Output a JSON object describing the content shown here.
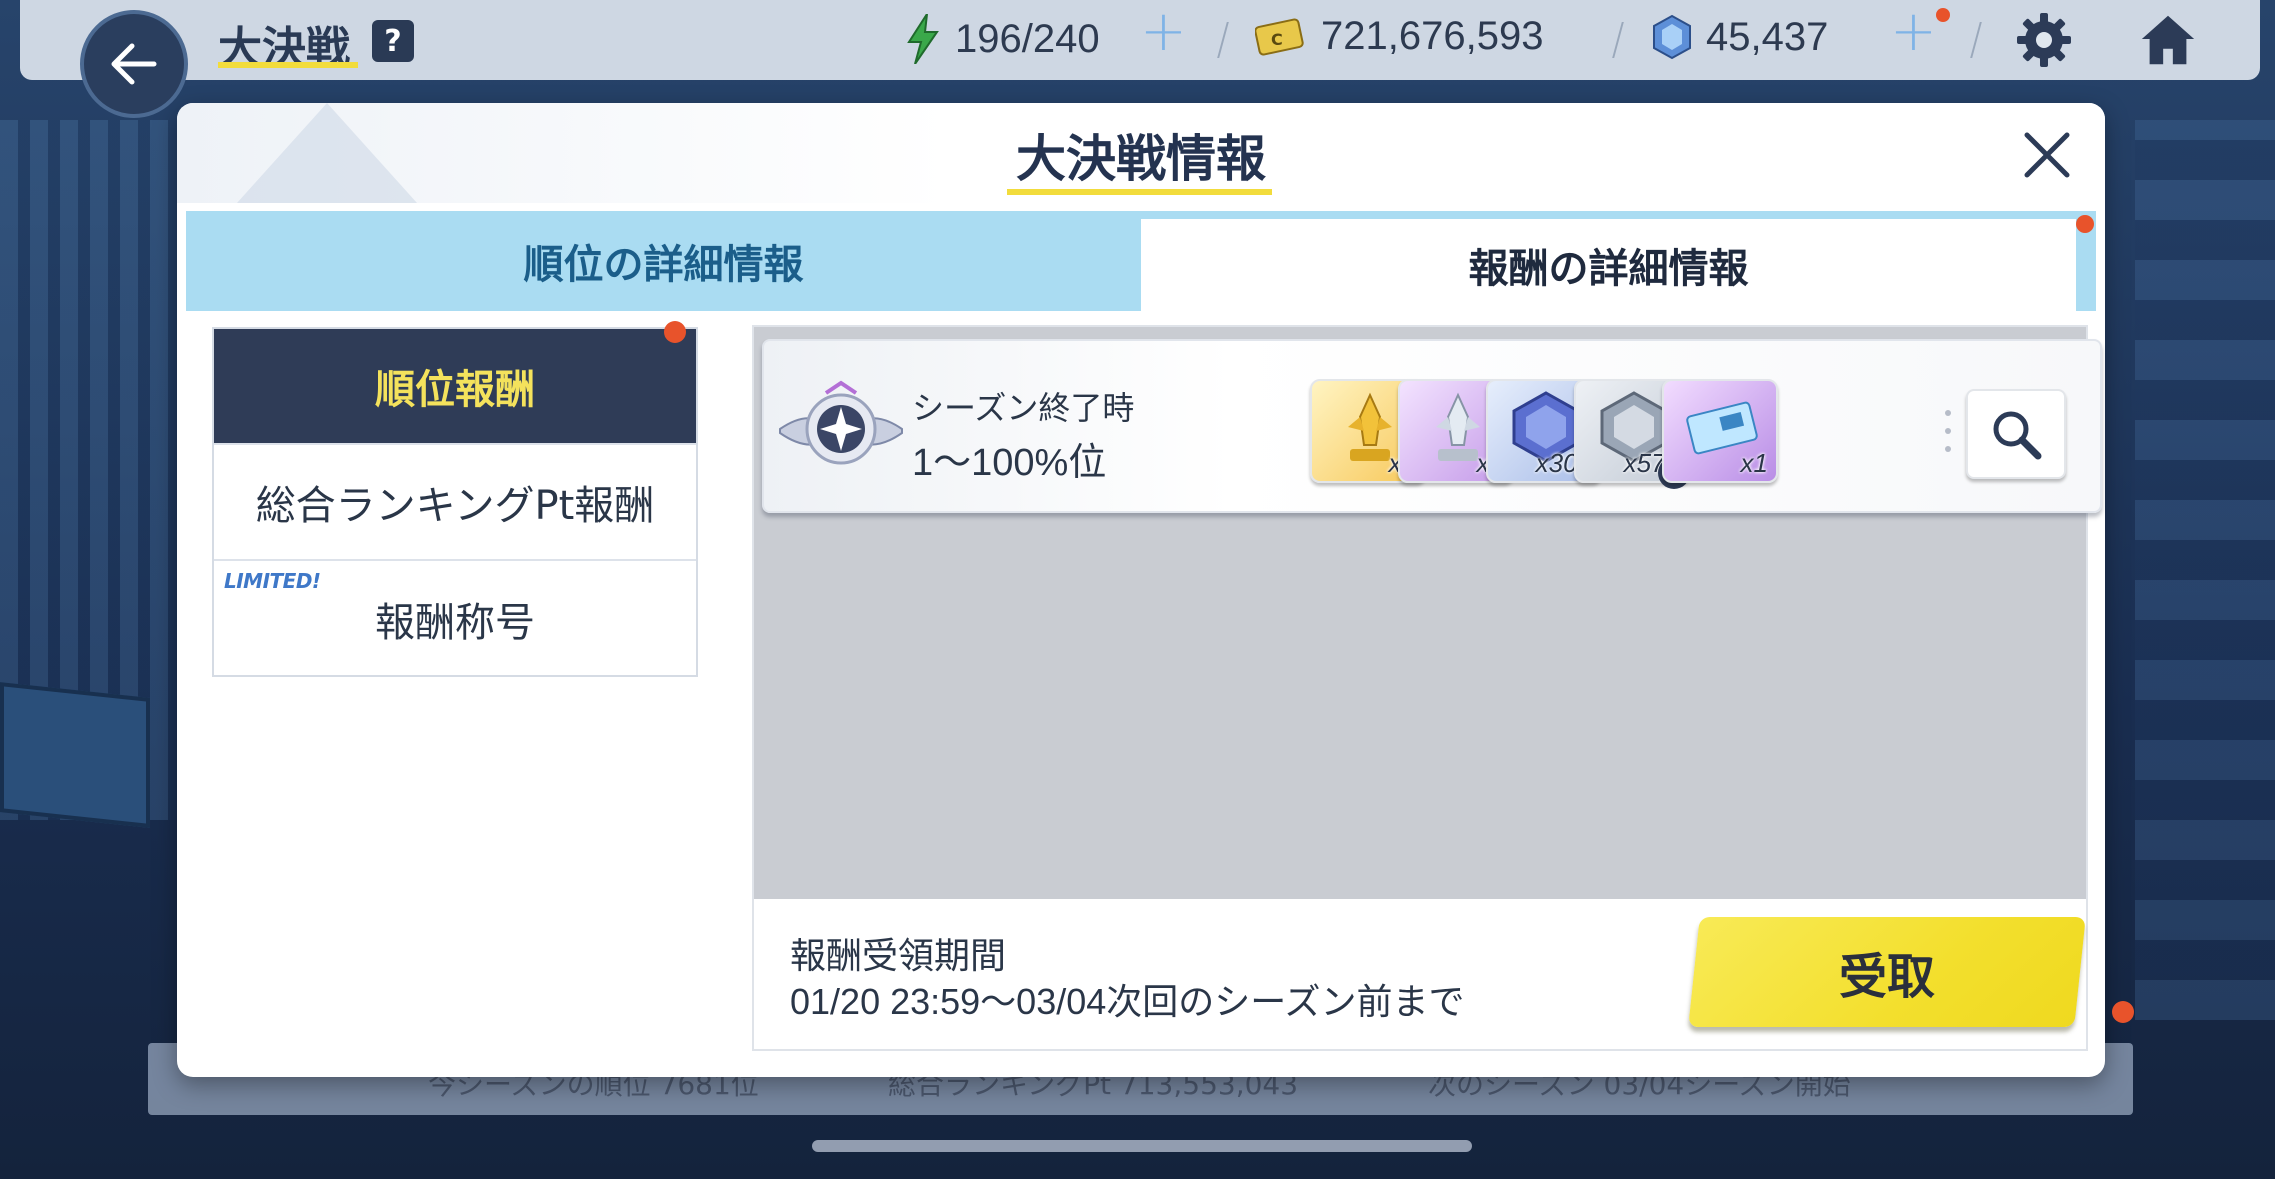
{
  "topbar": {
    "title": "大決戦",
    "help": "?",
    "stamina": "196/240",
    "credits": "721,676,593",
    "pyroxene": "45,437"
  },
  "bg_bar": {
    "season_rank": "今シーズンの順位 7681位",
    "total_pt": "総合ランキングPt 713,553,043",
    "next_season": "次のシーズン 03/04シーズン開始"
  },
  "modal": {
    "title": "大決戦情報",
    "tabs": [
      {
        "label": "順位の詳細情報"
      },
      {
        "label": "報酬の詳細情報"
      }
    ],
    "menu": [
      {
        "label": "順位報酬"
      },
      {
        "label": "総合ランキングPt報酬"
      },
      {
        "label": "報酬称号",
        "badge": "LIMITED!"
      }
    ],
    "reward": {
      "condition_line1": "シーズン終了時",
      "condition_line2": "1～100%位",
      "items": [
        {
          "icon": "gold-trophy-icon",
          "qty": "x1"
        },
        {
          "icon": "silver-trophy-icon",
          "qty": "x1"
        },
        {
          "icon": "blue-eleph-icon",
          "qty": "x300"
        },
        {
          "icon": "gray-eleph-icon",
          "qty": "x575"
        },
        {
          "icon": "ticket-icon",
          "qty": "x1"
        }
      ]
    },
    "footer": {
      "period_label": "報酬受領期間",
      "period_value": "01/20 23:59～03/04次回のシーズン前まで",
      "claim_label": "受取"
    }
  },
  "colors": {
    "accent_yellow": "#f3df2d",
    "dark_navy": "#2f3c57",
    "tab_blue": "#aadcf2",
    "red_dot": "#e8532b"
  }
}
